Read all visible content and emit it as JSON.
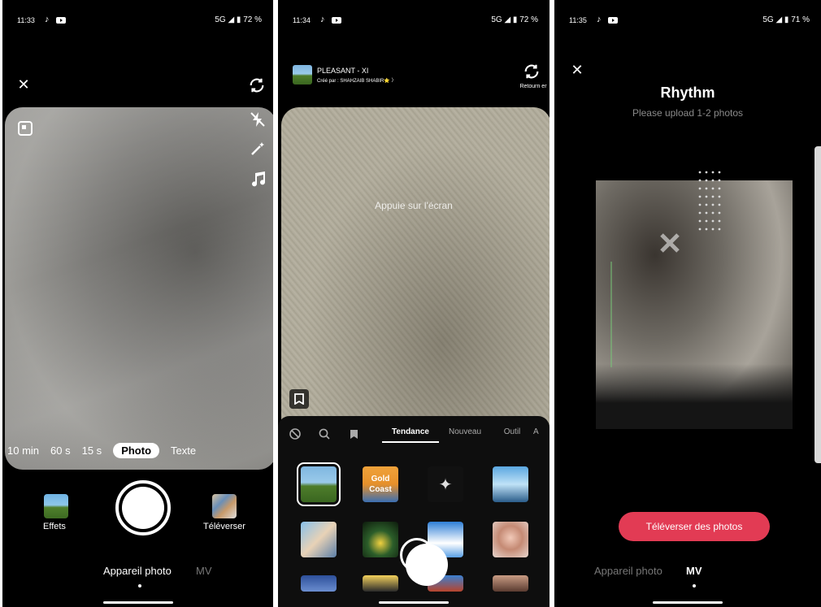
{
  "screens": [
    {
      "status": {
        "time": "11:33",
        "right": "5G ◢ ▮ 72 %"
      },
      "modes": [
        "10 min",
        "60 s",
        "15 s",
        "Photo",
        "Texte"
      ],
      "active_mode": "Photo",
      "effects_label": "Effets",
      "upload_label": "Téléverser",
      "bottom_tabs": [
        "Appareil photo",
        "MV"
      ]
    },
    {
      "status": {
        "time": "11:34",
        "right": "5G ◢ ▮ 72 %"
      },
      "effect_name": "PLEASANT - XI",
      "effect_creator": "Créé par : SHAHZAIB SHABIR⭐ 〉",
      "flip_label": "Retourn er",
      "hint": "Appuie sur l'écran",
      "tabs": [
        "Tendance",
        "Nouveau",
        "Outil",
        "A"
      ],
      "grid_labels": {
        "gold_coast": "Gold Coast"
      }
    },
    {
      "status": {
        "time": "11:35",
        "right": "5G ◢ ▮ 71 %"
      },
      "title": "Rhythm",
      "subtitle": "Please upload 1-2 photos",
      "upload_button": "Téléverser des photos",
      "bottom_tabs": [
        "Appareil photo",
        "MV"
      ]
    }
  ]
}
